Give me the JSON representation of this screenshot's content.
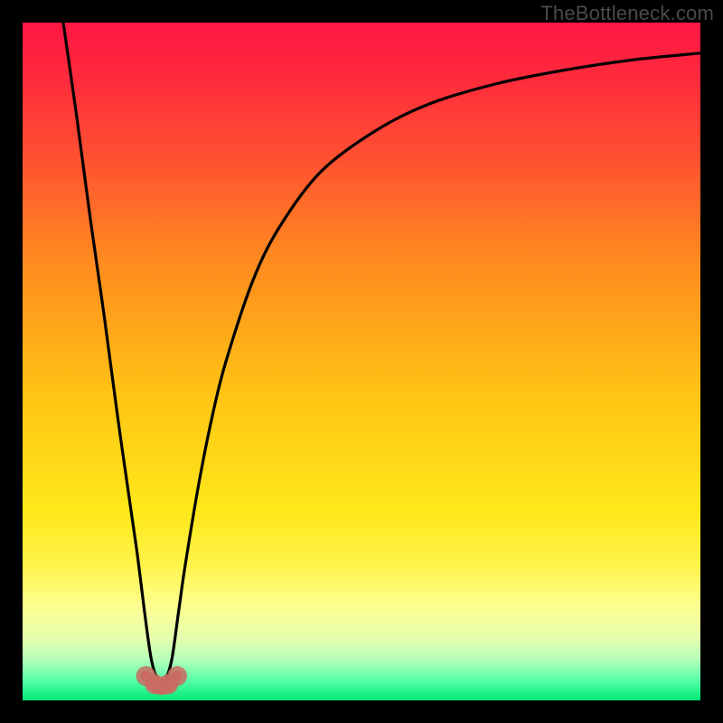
{
  "watermark": "TheBottleneck.com",
  "chart_data": {
    "type": "line",
    "title": "",
    "xlabel": "",
    "ylabel": "",
    "xlim": [
      0,
      100
    ],
    "ylim": [
      0,
      100
    ],
    "grid": false,
    "legend": false,
    "background_gradient": {
      "orientation": "vertical",
      "stops": [
        {
          "pos": 0.0,
          "color": "#ff1744"
        },
        {
          "pos": 0.08,
          "color": "#ff2a3c"
        },
        {
          "pos": 0.2,
          "color": "#ff5131"
        },
        {
          "pos": 0.35,
          "color": "#ff8a1f"
        },
        {
          "pos": 0.55,
          "color": "#ffc414"
        },
        {
          "pos": 0.72,
          "color": "#ffe81a"
        },
        {
          "pos": 0.8,
          "color": "#fff34a"
        },
        {
          "pos": 0.86,
          "color": "#fdff8f"
        },
        {
          "pos": 0.91,
          "color": "#e4ffb0"
        },
        {
          "pos": 0.94,
          "color": "#b4ffba"
        },
        {
          "pos": 0.97,
          "color": "#58ffa8"
        },
        {
          "pos": 1.0,
          "color": "#00e878"
        }
      ]
    },
    "series": [
      {
        "name": "bottleneck-curve",
        "color": "#000000",
        "x": [
          6,
          8,
          10,
          12,
          14,
          16,
          17,
          18,
          19,
          20,
          21,
          22,
          23,
          24,
          26,
          28,
          30,
          34,
          38,
          44,
          52,
          60,
          70,
          80,
          90,
          100
        ],
        "y": [
          100,
          86,
          71,
          57,
          42,
          28,
          21,
          13,
          6,
          3,
          3,
          6,
          13,
          20,
          32,
          42,
          50,
          62,
          70,
          78,
          84,
          88,
          91,
          93,
          94.5,
          95.5
        ]
      }
    ],
    "marker_group": {
      "name": "highlight-points",
      "color": "#c96b62",
      "radius_outer": 11,
      "radius_inner": 6,
      "points_x": [
        18.2,
        19.5,
        21.5,
        22.8
      ],
      "points_y": [
        3.6,
        2.4,
        2.4,
        3.6
      ]
    }
  }
}
